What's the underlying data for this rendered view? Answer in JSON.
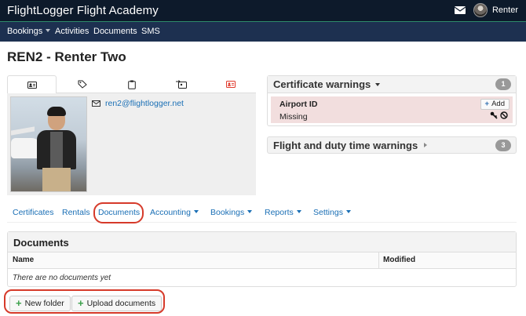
{
  "app": {
    "title": "FlightLogger Flight Academy"
  },
  "user": {
    "name": "Renter"
  },
  "nav": [
    {
      "label": "Bookings",
      "dropdown": true
    },
    {
      "label": "Activities",
      "dropdown": false
    },
    {
      "label": "Documents",
      "dropdown": false
    },
    {
      "label": "SMS",
      "dropdown": false
    }
  ],
  "page": {
    "title": "REN2 - Renter Two"
  },
  "profile": {
    "tabs": [
      "id-card-icon",
      "tag-icon",
      "clipboard-icon",
      "transfer-card-icon",
      "alert-card-icon"
    ],
    "email": "ren2@flightlogger.net"
  },
  "certificate_warnings": {
    "title": "Certificate warnings",
    "count": "1",
    "item": {
      "name": "Airport ID",
      "status": "Missing",
      "add_label": "Add"
    }
  },
  "flight_duty_warnings": {
    "title": "Flight and duty time warnings",
    "count": "3"
  },
  "subtabs": [
    {
      "label": "Certificates",
      "dropdown": false
    },
    {
      "label": "Rentals",
      "dropdown": false
    },
    {
      "label": "Documents",
      "dropdown": false,
      "active": true
    },
    {
      "label": "Accounting",
      "dropdown": true
    },
    {
      "label": "Bookings",
      "dropdown": true
    },
    {
      "label": "Reports",
      "dropdown": true
    },
    {
      "label": "Settings",
      "dropdown": true
    }
  ],
  "documents": {
    "title": "Documents",
    "columns": {
      "name": "Name",
      "modified": "Modified"
    },
    "empty": "There are no documents yet",
    "new_folder": "New folder",
    "upload": "Upload documents"
  },
  "colors": {
    "topbar": "#0d1a2b",
    "navbar": "#1d3050",
    "link": "#1a6fb5",
    "highlight": "#d63a2a",
    "warning_bg": "#f2dede"
  }
}
